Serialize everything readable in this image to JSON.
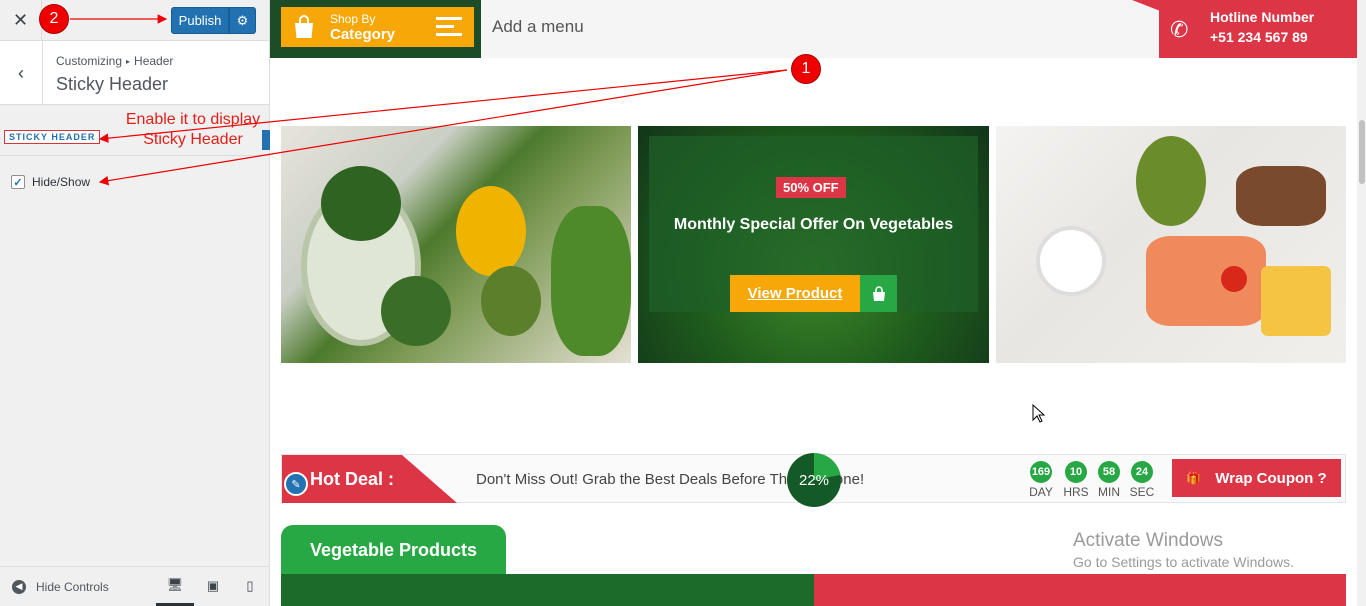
{
  "customizer": {
    "close_icon": "close-icon",
    "publish_label": "Publish",
    "settings_icon": "gear-icon",
    "breadcrumb_root": "Customizing",
    "breadcrumb_section": "Header",
    "section_title": "Sticky Header",
    "sticky_header_label": "STICKY HEADER",
    "hide_show_label": "Hide/Show",
    "hide_show_checked": true,
    "hide_controls_label": "Hide Controls",
    "devices": [
      "desktop",
      "tablet",
      "mobile"
    ],
    "active_device": "desktop"
  },
  "annotations": {
    "step1": "1",
    "step2": "2",
    "note_line1": "Enable it to display",
    "note_line2": "Sticky Header"
  },
  "site": {
    "shop_by": "Shop By",
    "category": "Category",
    "add_menu": "Add a menu",
    "hotline_title": "Hotline Number",
    "hotline_number": "+51 234 567 89",
    "offer_badge": "50% OFF",
    "offer_title": "Monthly Special Offer On Vegetables",
    "view_product": "View Product",
    "hot_deal_label": "Hot Deal :",
    "deal_text": "Don't Miss Out! Grab the Best Deals Before They're Gone!",
    "progress": "22%",
    "countdown": [
      {
        "value": "169",
        "unit": "DAY"
      },
      {
        "value": "10",
        "unit": "HRS"
      },
      {
        "value": "58",
        "unit": "MIN"
      },
      {
        "value": "24",
        "unit": "SEC"
      }
    ],
    "coupon_label": "Wrap Coupon ?",
    "products_tab": "Vegetable Products"
  },
  "watermark": {
    "line1": "Activate Windows",
    "line2": "Go to Settings to activate Windows."
  },
  "colors": {
    "wp_blue": "#2271b1",
    "brand_green": "#1c4d26",
    "accent_orange": "#f7a707",
    "accent_red": "#dc3545",
    "badge_green": "#28a745"
  }
}
